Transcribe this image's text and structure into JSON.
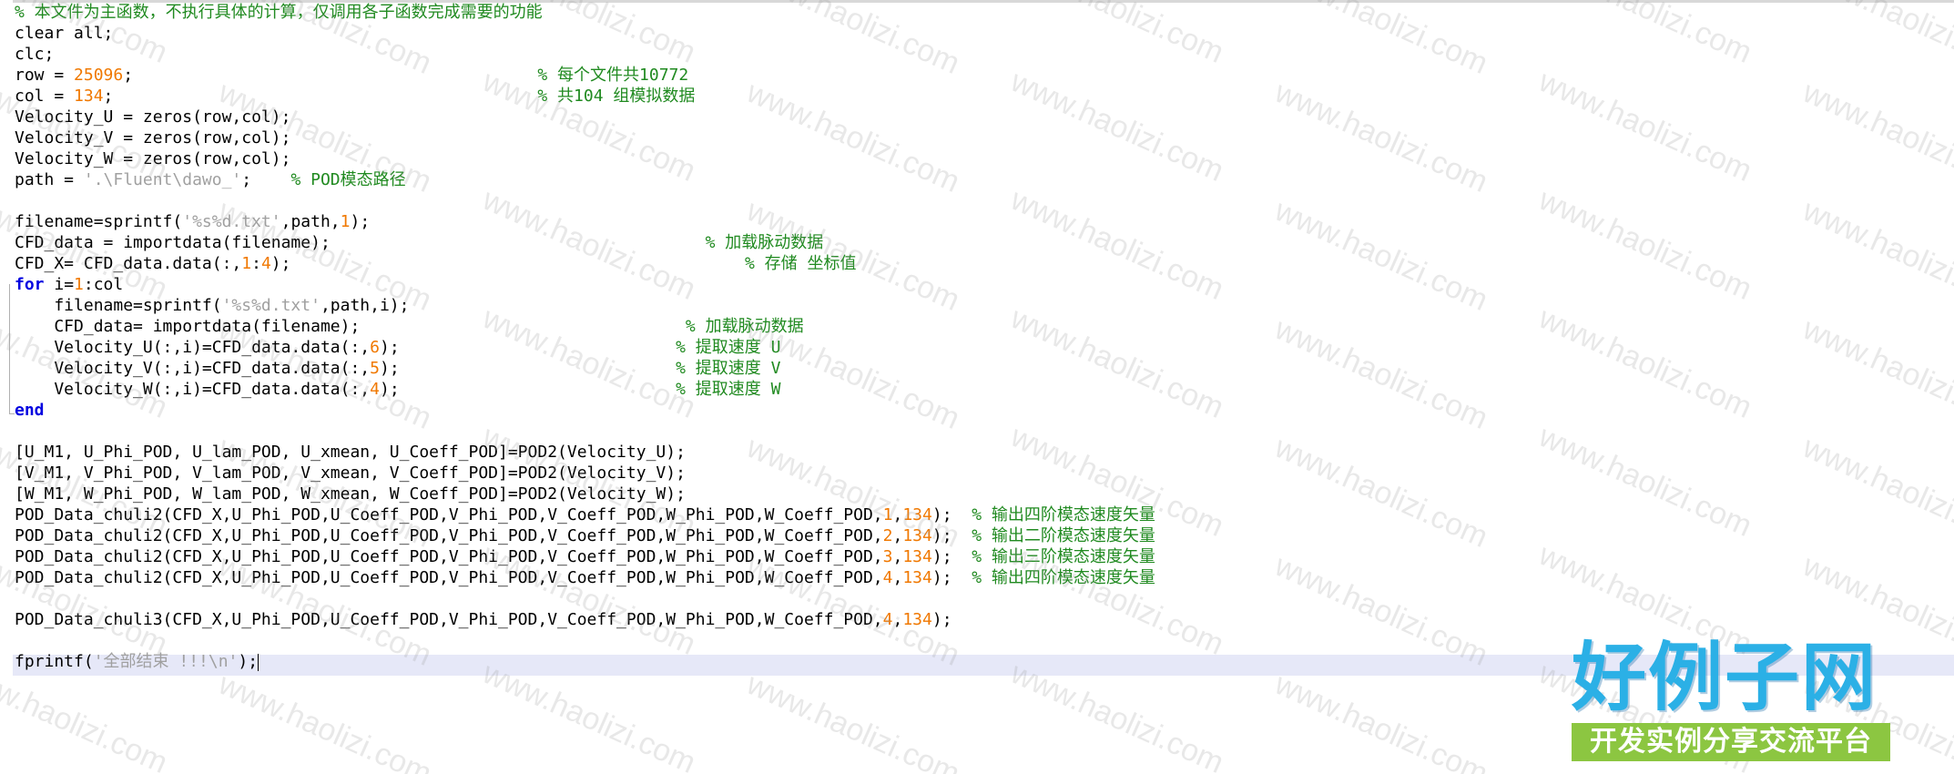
{
  "editor": {
    "lines": [
      [
        {
          "t": "% 本文件为主函数，不执行具体的计算，仅调用各子函数完成需要的功能",
          "c": "cmt"
        }
      ],
      [
        {
          "t": "clear all;",
          "c": ""
        }
      ],
      [
        {
          "t": "clc;",
          "c": ""
        }
      ],
      [
        {
          "t": "row = ",
          "c": ""
        },
        {
          "t": "25096",
          "c": "num"
        },
        {
          "t": ";                                         ",
          "c": ""
        },
        {
          "t": "% 每个文件共10772",
          "c": "cmt"
        }
      ],
      [
        {
          "t": "col = ",
          "c": ""
        },
        {
          "t": "134",
          "c": "num"
        },
        {
          "t": ";                                           ",
          "c": ""
        },
        {
          "t": "% 共104 组模拟数据",
          "c": "cmt"
        }
      ],
      [
        {
          "t": "Velocity_U = zeros(row,col);",
          "c": ""
        }
      ],
      [
        {
          "t": "Velocity_V = zeros(row,col);",
          "c": ""
        }
      ],
      [
        {
          "t": "Velocity_W = zeros(row,col);",
          "c": ""
        }
      ],
      [
        {
          "t": "path = ",
          "c": ""
        },
        {
          "t": "'.\\Fluent\\dawo_'",
          "c": "str"
        },
        {
          "t": ";    ",
          "c": ""
        },
        {
          "t": "% POD模态路径",
          "c": "cmt"
        }
      ],
      [
        {
          "t": "",
          "c": ""
        }
      ],
      [
        {
          "t": "filename=sprintf(",
          "c": ""
        },
        {
          "t": "'%s%d.txt'",
          "c": "str"
        },
        {
          "t": ",path,",
          "c": ""
        },
        {
          "t": "1",
          "c": "num"
        },
        {
          "t": ");",
          "c": ""
        }
      ],
      [
        {
          "t": "CFD_data = importdata(filename);                                      ",
          "c": ""
        },
        {
          "t": "% 加载脉动数据",
          "c": "cmt"
        }
      ],
      [
        {
          "t": "CFD_X= CFD_data.data(:,",
          "c": ""
        },
        {
          "t": "1",
          "c": "num"
        },
        {
          "t": ":",
          "c": ""
        },
        {
          "t": "4",
          "c": "num"
        },
        {
          "t": ");                                              ",
          "c": ""
        },
        {
          "t": "% 存储 坐标值",
          "c": "cmt"
        }
      ],
      [
        {
          "t": "for",
          "c": "kw"
        },
        {
          "t": " i=",
          "c": ""
        },
        {
          "t": "1",
          "c": "num"
        },
        {
          "t": ":col",
          "c": ""
        }
      ],
      [
        {
          "t": "    filename=sprintf(",
          "c": ""
        },
        {
          "t": "'%s%d.txt'",
          "c": "str"
        },
        {
          "t": ",path,i);",
          "c": ""
        }
      ],
      [
        {
          "t": "    CFD_data= importdata(filename);                                 ",
          "c": ""
        },
        {
          "t": "% 加载脉动数据",
          "c": "cmt"
        }
      ],
      [
        {
          "t": "    Velocity_U(:,i)=CFD_data.data(:,",
          "c": ""
        },
        {
          "t": "6",
          "c": "num"
        },
        {
          "t": ");                            ",
          "c": ""
        },
        {
          "t": "% 提取速度 U",
          "c": "cmt"
        }
      ],
      [
        {
          "t": "    Velocity_V(:,i)=CFD_data.data(:,",
          "c": ""
        },
        {
          "t": "5",
          "c": "num"
        },
        {
          "t": ");                            ",
          "c": ""
        },
        {
          "t": "% 提取速度 V",
          "c": "cmt"
        }
      ],
      [
        {
          "t": "    Velocity_W(:,i)=CFD_data.data(:,",
          "c": ""
        },
        {
          "t": "4",
          "c": "num"
        },
        {
          "t": ");                            ",
          "c": ""
        },
        {
          "t": "% 提取速度 W",
          "c": "cmt"
        }
      ],
      [
        {
          "t": "end",
          "c": "kw"
        }
      ],
      [
        {
          "t": "",
          "c": ""
        }
      ],
      [
        {
          "t": "[U_M1, U_Phi_POD, U_lam_POD, U_xmean, U_Coeff_POD]=POD2(Velocity_U);",
          "c": ""
        }
      ],
      [
        {
          "t": "[V_M1, V_Phi_POD, V_lam_POD, V_xmean, V_Coeff_POD]=POD2(Velocity_V);",
          "c": ""
        }
      ],
      [
        {
          "t": "[W_M1, W_Phi_POD, W_lam_POD, W_xmean, W_Coeff_POD]=POD2(Velocity_W);",
          "c": ""
        }
      ],
      [
        {
          "t": "POD_Data_chuli2(CFD_X,U_Phi_POD,U_Coeff_POD,V_Phi_POD,V_Coeff_POD,W_Phi_POD,W_Coeff_POD,",
          "c": ""
        },
        {
          "t": "1",
          "c": "num"
        },
        {
          "t": ",",
          "c": ""
        },
        {
          "t": "134",
          "c": "num"
        },
        {
          "t": ");  ",
          "c": ""
        },
        {
          "t": "% 输出四阶模态速度矢量",
          "c": "cmt"
        }
      ],
      [
        {
          "t": "POD_Data_chuli2(CFD_X,U_Phi_POD,U_Coeff_POD,V_Phi_POD,V_Coeff_POD,W_Phi_POD,W_Coeff_POD,",
          "c": ""
        },
        {
          "t": "2",
          "c": "num"
        },
        {
          "t": ",",
          "c": ""
        },
        {
          "t": "134",
          "c": "num"
        },
        {
          "t": ");  ",
          "c": ""
        },
        {
          "t": "% 输出二阶模态速度矢量",
          "c": "cmt"
        }
      ],
      [
        {
          "t": "POD_Data_chuli2(CFD_X,U_Phi_POD,U_Coeff_POD,V_Phi_POD,V_Coeff_POD,W_Phi_POD,W_Coeff_POD,",
          "c": ""
        },
        {
          "t": "3",
          "c": "num"
        },
        {
          "t": ",",
          "c": ""
        },
        {
          "t": "134",
          "c": "num"
        },
        {
          "t": ");  ",
          "c": ""
        },
        {
          "t": "% 输出三阶模态速度矢量",
          "c": "cmt"
        }
      ],
      [
        {
          "t": "POD_Data_chuli2(CFD_X,U_Phi_POD,U_Coeff_POD,V_Phi_POD,V_Coeff_POD,W_Phi_POD,W_Coeff_POD,",
          "c": ""
        },
        {
          "t": "4",
          "c": "num"
        },
        {
          "t": ",",
          "c": ""
        },
        {
          "t": "134",
          "c": "num"
        },
        {
          "t": ");  ",
          "c": ""
        },
        {
          "t": "% 输出四阶模态速度矢量",
          "c": "cmt"
        }
      ],
      [
        {
          "t": "",
          "c": ""
        }
      ],
      [
        {
          "t": "POD_Data_chuli3(CFD_X,U_Phi_POD,U_Coeff_POD,V_Phi_POD,V_Coeff_POD,W_Phi_POD,W_Coeff_POD,",
          "c": ""
        },
        {
          "t": "4",
          "c": "num"
        },
        {
          "t": ",",
          "c": ""
        },
        {
          "t": "134",
          "c": "num"
        },
        {
          "t": ");",
          "c": ""
        }
      ],
      [
        {
          "t": "",
          "c": ""
        }
      ],
      [
        {
          "t": "fprintf(",
          "c": ""
        },
        {
          "t": "'全部结束 !!!\\n'",
          "c": "str"
        },
        {
          "t": ");",
          "c": ""
        }
      ]
    ],
    "current_line_index": 31
  },
  "watermark": {
    "text": "www.haolizi.com"
  },
  "logo": {
    "title": "好例子网",
    "subtitle": "开发实例分享交流平台"
  },
  "colors": {
    "keyword": "#0000e0",
    "number": "#f07800",
    "string": "#a0a0a0",
    "comment": "#208a20",
    "current_line": "#e6e8f8",
    "logo_blue": "#2bb0e6",
    "logo_green": "#8cc641"
  }
}
